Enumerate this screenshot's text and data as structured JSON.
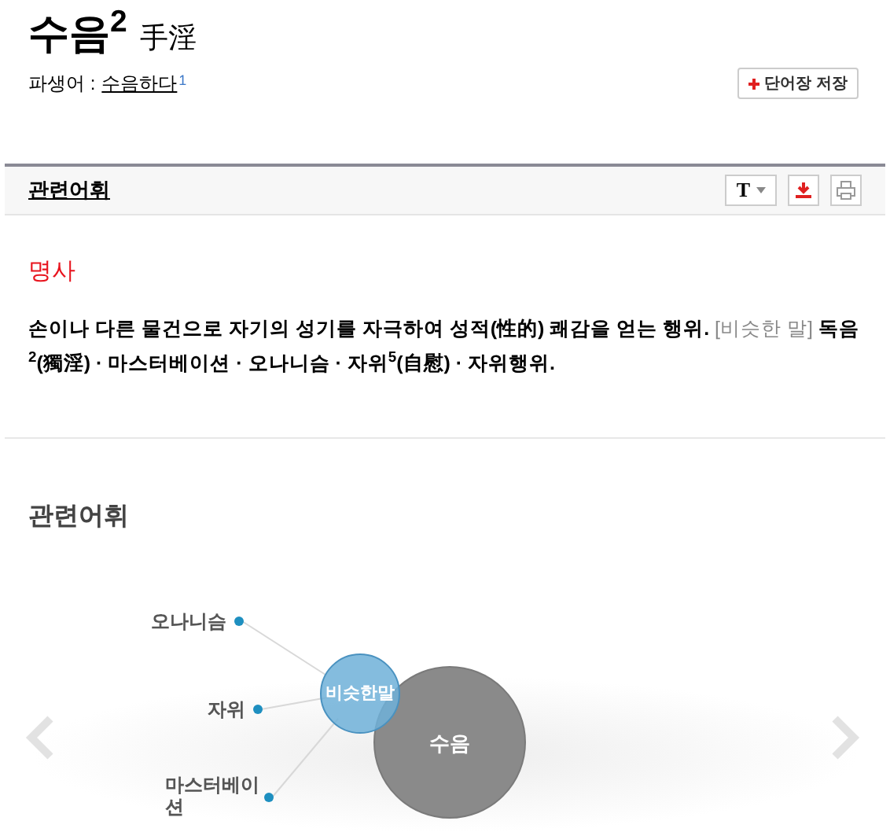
{
  "entry": {
    "headword": "수음$^{2}$",
    "hanja": "手淫",
    "derivative_label": "파생어 :",
    "derivative": "수음하다",
    "derivative_sup": "1",
    "save_button": "단어장 저장"
  },
  "section_bar": {
    "title": "관련어휘",
    "font_button": "T"
  },
  "sense": {
    "pos": "명사",
    "definition": "손이나 다른 물건으로 자기의 성기를 자극하여 성적(性的) 쾌감을 얻는 행위.",
    "similar_label": "[비슷한 말]",
    "similar_words": "독음$^{2}$(獨淫) · 마스터베이션 · 오나니슴 · 자위$^{5}$(自慰) · 자위행위."
  },
  "related": {
    "heading": "관련어휘",
    "hub": "비슷한말",
    "center": "수음",
    "words": [
      {
        "label": "오나니슴"
      },
      {
        "label": "자위"
      },
      {
        "label": "마스터베이션"
      }
    ]
  }
}
